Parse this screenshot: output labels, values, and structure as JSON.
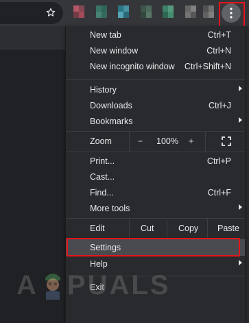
{
  "menu": {
    "items_top": [
      {
        "label": "New tab",
        "shortcut": "Ctrl+T"
      },
      {
        "label": "New window",
        "shortcut": "Ctrl+N"
      },
      {
        "label": "New incognito window",
        "shortcut": "Ctrl+Shift+N"
      }
    ],
    "history": {
      "label": "History"
    },
    "downloads": {
      "label": "Downloads",
      "shortcut": "Ctrl+J"
    },
    "bookmarks": {
      "label": "Bookmarks"
    },
    "zoom": {
      "label": "Zoom",
      "minus": "−",
      "value": "100%",
      "plus": "+"
    },
    "print": {
      "label": "Print...",
      "shortcut": "Ctrl+P"
    },
    "cast": {
      "label": "Cast..."
    },
    "find": {
      "label": "Find...",
      "shortcut": "Ctrl+F"
    },
    "more_tools": {
      "label": "More tools"
    },
    "edit": {
      "label": "Edit",
      "cut": "Cut",
      "copy": "Copy",
      "paste": "Paste"
    },
    "settings": {
      "label": "Settings"
    },
    "help": {
      "label": "Help"
    },
    "exit": {
      "label": "Exit"
    }
  },
  "watermark": {
    "text_left": "A",
    "text_right": "PUALS"
  },
  "colors": {
    "highlight": "#e8141b",
    "menu_bg": "#292a2d",
    "toolbar_bg": "#35363a",
    "settings_bg": "#4a4b4f"
  },
  "icons": {
    "star": "star-icon",
    "menu": "three-dots-vertical-icon",
    "fullscreen": "fullscreen-icon",
    "submenu": "chevron-right-icon"
  }
}
